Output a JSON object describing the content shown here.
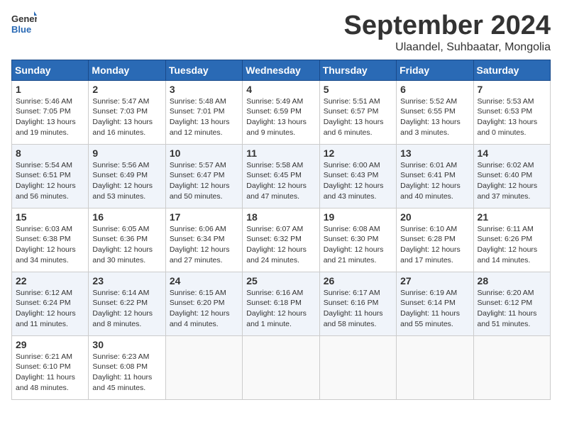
{
  "logo": {
    "general": "General",
    "blue": "Blue"
  },
  "title": "September 2024",
  "subtitle": "Ulaandel, Suhbaatar, Mongolia",
  "weekdays": [
    "Sunday",
    "Monday",
    "Tuesday",
    "Wednesday",
    "Thursday",
    "Friday",
    "Saturday"
  ],
  "weeks": [
    [
      {
        "day": 1,
        "info": "Sunrise: 5:46 AM\nSunset: 7:05 PM\nDaylight: 13 hours\nand 19 minutes."
      },
      {
        "day": 2,
        "info": "Sunrise: 5:47 AM\nSunset: 7:03 PM\nDaylight: 13 hours\nand 16 minutes."
      },
      {
        "day": 3,
        "info": "Sunrise: 5:48 AM\nSunset: 7:01 PM\nDaylight: 13 hours\nand 12 minutes."
      },
      {
        "day": 4,
        "info": "Sunrise: 5:49 AM\nSunset: 6:59 PM\nDaylight: 13 hours\nand 9 minutes."
      },
      {
        "day": 5,
        "info": "Sunrise: 5:51 AM\nSunset: 6:57 PM\nDaylight: 13 hours\nand 6 minutes."
      },
      {
        "day": 6,
        "info": "Sunrise: 5:52 AM\nSunset: 6:55 PM\nDaylight: 13 hours\nand 3 minutes."
      },
      {
        "day": 7,
        "info": "Sunrise: 5:53 AM\nSunset: 6:53 PM\nDaylight: 13 hours\nand 0 minutes."
      }
    ],
    [
      {
        "day": 8,
        "info": "Sunrise: 5:54 AM\nSunset: 6:51 PM\nDaylight: 12 hours\nand 56 minutes."
      },
      {
        "day": 9,
        "info": "Sunrise: 5:56 AM\nSunset: 6:49 PM\nDaylight: 12 hours\nand 53 minutes."
      },
      {
        "day": 10,
        "info": "Sunrise: 5:57 AM\nSunset: 6:47 PM\nDaylight: 12 hours\nand 50 minutes."
      },
      {
        "day": 11,
        "info": "Sunrise: 5:58 AM\nSunset: 6:45 PM\nDaylight: 12 hours\nand 47 minutes."
      },
      {
        "day": 12,
        "info": "Sunrise: 6:00 AM\nSunset: 6:43 PM\nDaylight: 12 hours\nand 43 minutes."
      },
      {
        "day": 13,
        "info": "Sunrise: 6:01 AM\nSunset: 6:41 PM\nDaylight: 12 hours\nand 40 minutes."
      },
      {
        "day": 14,
        "info": "Sunrise: 6:02 AM\nSunset: 6:40 PM\nDaylight: 12 hours\nand 37 minutes."
      }
    ],
    [
      {
        "day": 15,
        "info": "Sunrise: 6:03 AM\nSunset: 6:38 PM\nDaylight: 12 hours\nand 34 minutes."
      },
      {
        "day": 16,
        "info": "Sunrise: 6:05 AM\nSunset: 6:36 PM\nDaylight: 12 hours\nand 30 minutes."
      },
      {
        "day": 17,
        "info": "Sunrise: 6:06 AM\nSunset: 6:34 PM\nDaylight: 12 hours\nand 27 minutes."
      },
      {
        "day": 18,
        "info": "Sunrise: 6:07 AM\nSunset: 6:32 PM\nDaylight: 12 hours\nand 24 minutes."
      },
      {
        "day": 19,
        "info": "Sunrise: 6:08 AM\nSunset: 6:30 PM\nDaylight: 12 hours\nand 21 minutes."
      },
      {
        "day": 20,
        "info": "Sunrise: 6:10 AM\nSunset: 6:28 PM\nDaylight: 12 hours\nand 17 minutes."
      },
      {
        "day": 21,
        "info": "Sunrise: 6:11 AM\nSunset: 6:26 PM\nDaylight: 12 hours\nand 14 minutes."
      }
    ],
    [
      {
        "day": 22,
        "info": "Sunrise: 6:12 AM\nSunset: 6:24 PM\nDaylight: 12 hours\nand 11 minutes."
      },
      {
        "day": 23,
        "info": "Sunrise: 6:14 AM\nSunset: 6:22 PM\nDaylight: 12 hours\nand 8 minutes."
      },
      {
        "day": 24,
        "info": "Sunrise: 6:15 AM\nSunset: 6:20 PM\nDaylight: 12 hours\nand 4 minutes."
      },
      {
        "day": 25,
        "info": "Sunrise: 6:16 AM\nSunset: 6:18 PM\nDaylight: 12 hours\nand 1 minute."
      },
      {
        "day": 26,
        "info": "Sunrise: 6:17 AM\nSunset: 6:16 PM\nDaylight: 11 hours\nand 58 minutes."
      },
      {
        "day": 27,
        "info": "Sunrise: 6:19 AM\nSunset: 6:14 PM\nDaylight: 11 hours\nand 55 minutes."
      },
      {
        "day": 28,
        "info": "Sunrise: 6:20 AM\nSunset: 6:12 PM\nDaylight: 11 hours\nand 51 minutes."
      }
    ],
    [
      {
        "day": 29,
        "info": "Sunrise: 6:21 AM\nSunset: 6:10 PM\nDaylight: 11 hours\nand 48 minutes."
      },
      {
        "day": 30,
        "info": "Sunrise: 6:23 AM\nSunset: 6:08 PM\nDaylight: 11 hours\nand 45 minutes."
      },
      null,
      null,
      null,
      null,
      null
    ]
  ]
}
